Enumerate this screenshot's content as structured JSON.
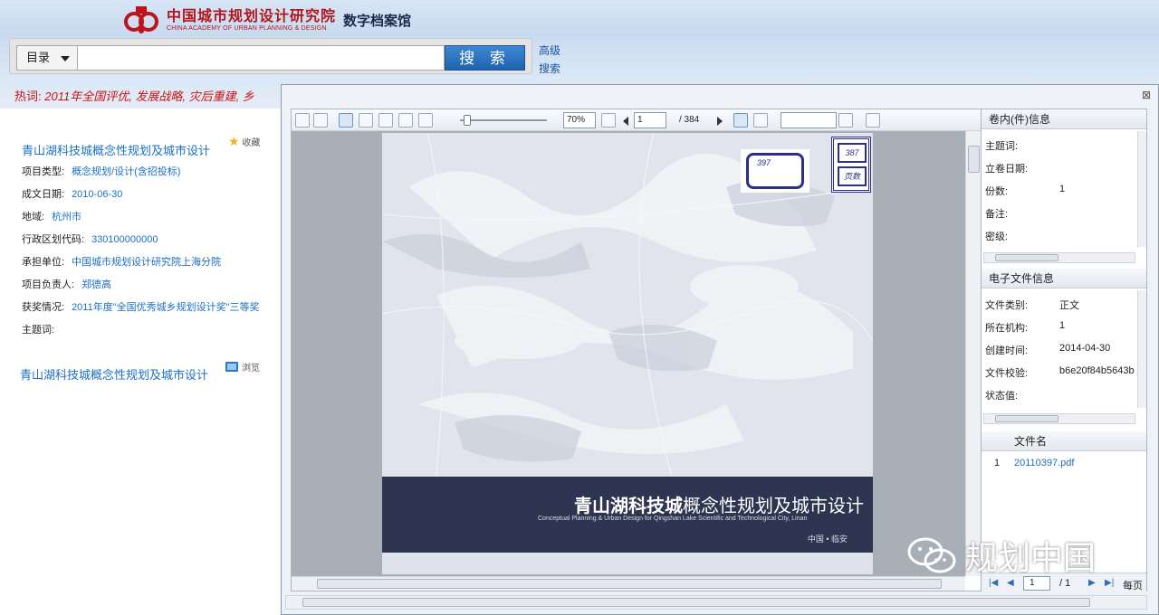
{
  "header": {
    "org_name_cn": "中国城市规划设计研究院",
    "org_name_en": "CHINA ACADEMY OF URBAN PLANNING & DESIGN",
    "app_title": "数字档案馆"
  },
  "search": {
    "scope_label": "目录",
    "query": "",
    "button_label": "搜 索",
    "advanced_label": "高级搜索"
  },
  "hot": {
    "label": "热词:",
    "terms": "2011年全国评优, 发展战略, 灾后重建, 乡"
  },
  "record": {
    "title": "青山湖科技城概念性规划及城市设计",
    "favorite_label": "收藏",
    "fields": [
      {
        "label": "项目类型:",
        "value": "概念规划/设计(含招投标)"
      },
      {
        "label": "成文日期:",
        "value": "2010-06-30"
      },
      {
        "label": "地域:",
        "value": "杭州市"
      },
      {
        "label": "行政区划代码:",
        "value": "330100000000"
      },
      {
        "label": "承担单位:",
        "value": "中国城市规划设计研究院上海分院"
      },
      {
        "label": "项目负责人:",
        "value": "郑德高"
      },
      {
        "label": "获奖情况:",
        "value": "2011年度\"全国优秀城乡规划设计奖\"三等奖"
      },
      {
        "label": "主题词:",
        "value": ""
      }
    ],
    "file_title": "青山湖科技城概念性规划及城市设计",
    "browse_label": "浏览"
  },
  "viewer": {
    "close_symbol": "⊠",
    "zoom": "70%",
    "page_current": "1",
    "page_total": "/ 384",
    "cover": {
      "title_bold": "青山湖科技城",
      "title_rest": "概念性规划及城市设计",
      "subtitle": "Conceptual Planning & Urban Design for Qingshan Lake Scientific and Technological City, Linan",
      "place": "中国 • 临安",
      "stamp_a": "397",
      "stamp_b": "387",
      "stamp_c": "页数"
    }
  },
  "properties": {
    "volume_header": "卷内(件)信息",
    "volume_rows": [
      {
        "label": "主题词:",
        "value": ""
      },
      {
        "label": "立卷日期:",
        "value": ""
      },
      {
        "label": "份数:",
        "value": "1"
      },
      {
        "label": "备注:",
        "value": ""
      },
      {
        "label": "密级:",
        "value": ""
      }
    ],
    "efile_header": "电子文件信息",
    "efile_rows": [
      {
        "label": "文件类别:",
        "value": "正文"
      },
      {
        "label": "所在机构:",
        "value": "1"
      },
      {
        "label": "创建时间:",
        "value": "2014-04-30"
      },
      {
        "label": "文件校验:",
        "value": "b6e20f84b5643b"
      },
      {
        "label": "状态值:",
        "value": ""
      }
    ],
    "file_col_header": "文件名",
    "file_index": "1",
    "file_name": "20110397.pdf",
    "pager_current": "1",
    "pager_total": "/ 1",
    "pager_per_page": "每页"
  },
  "watermark": {
    "text": "规划中国"
  },
  "colors": {
    "brand_red": "#b5141c",
    "link_blue": "#1c6fc4",
    "search_btn": "#2a6fbe",
    "cover_band": "#2d3551"
  }
}
